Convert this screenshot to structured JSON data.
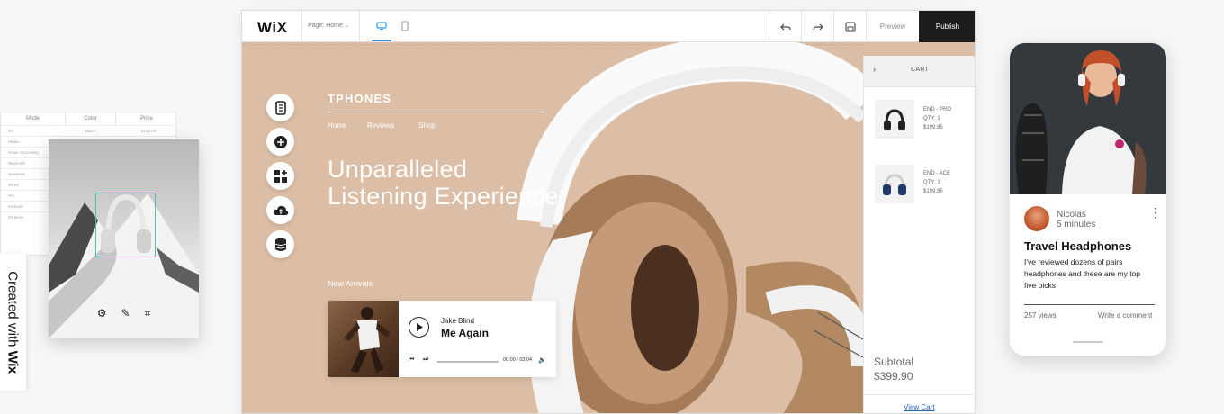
{
  "spreadsheet": {
    "headers": [
      "Mode",
      "Color",
      "Price"
    ],
    "row1": [
      "Sit",
      "Black",
      "$100.00"
    ],
    "rows": [
      "Studio",
      "Noise Cancelling",
      "Bluetooth",
      "Speakers",
      "Wired",
      "Pro",
      "Earbuds",
      "Wireless"
    ]
  },
  "badge": {
    "prefix": "Created with",
    "brand": "Wix"
  },
  "topbar": {
    "logo": "WiX",
    "page_selector": "Page: Home",
    "preview": "Preview",
    "publish": "Publish"
  },
  "site": {
    "brand": "TPHONES",
    "nav": [
      "Home",
      "Reviews",
      "Shop"
    ],
    "hero_line1": "Unparalleled",
    "hero_line2": "Listening Experience",
    "new_arrivals": "New Arrivals"
  },
  "player": {
    "artist": "Jake Blind",
    "track": "Me Again",
    "time": "00:00 / 03:04",
    "progress": 0.0
  },
  "cart": {
    "title": "CART",
    "items": [
      {
        "name": "END - PRO",
        "qty": "QTY: 1",
        "price": "$199.95"
      },
      {
        "name": "END - ACE",
        "qty": "QTY: 1",
        "price": "$199.95"
      }
    ],
    "subtotal_label": "Subtotal",
    "subtotal_value": "$399.90",
    "view_cart": "View Cart"
  },
  "phone": {
    "author": "Nicolas",
    "time_ago": "5 minutes",
    "title": "Travel Headphones",
    "body": "I've reviewed dozens of pairs headphones and these are my top five picks",
    "views": "257 views",
    "write_comment": "Write a comment"
  },
  "colors": {
    "canvas": "#dcbea6",
    "accent": "#3899ec",
    "publish_bg": "#1c1c1c",
    "link": "#2b63b3"
  },
  "icons": {
    "rail": [
      "pages-icon",
      "add-icon",
      "add-apps-icon",
      "upload-icon",
      "database-icon"
    ],
    "editor_tools": [
      "settings-icon",
      "edit-icon",
      "crop-icon"
    ]
  }
}
